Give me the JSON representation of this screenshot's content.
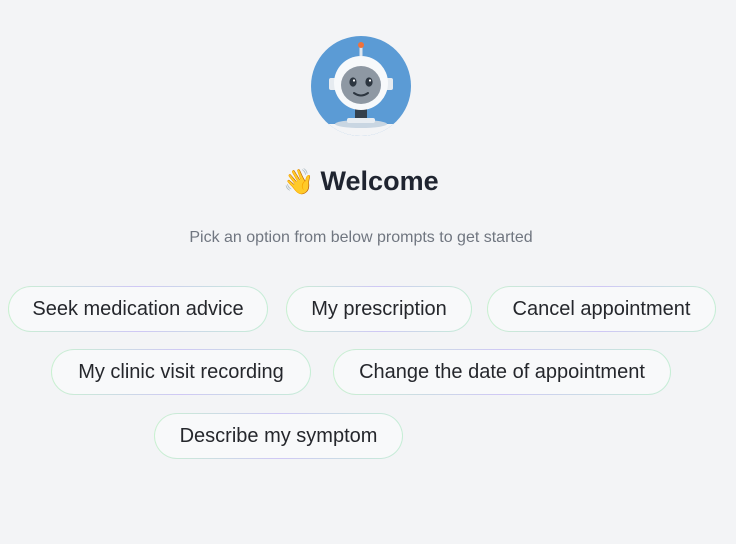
{
  "assistant": {
    "avatar_icon": "robot-astronaut-icon",
    "colors": {
      "avatar_background": "#5b9bd5",
      "background": "#f3f4f6"
    }
  },
  "welcome": {
    "emoji": "👋",
    "title": "Welcome",
    "subtitle": "Pick an option from below prompts to get started"
  },
  "prompts": [
    {
      "label": "Seek medication advice"
    },
    {
      "label": "My prescription"
    },
    {
      "label": "Cancel appointment"
    },
    {
      "label": "My clinic visit recording"
    },
    {
      "label": "Change the date of appointment"
    },
    {
      "label": "Describe my symptom"
    }
  ]
}
